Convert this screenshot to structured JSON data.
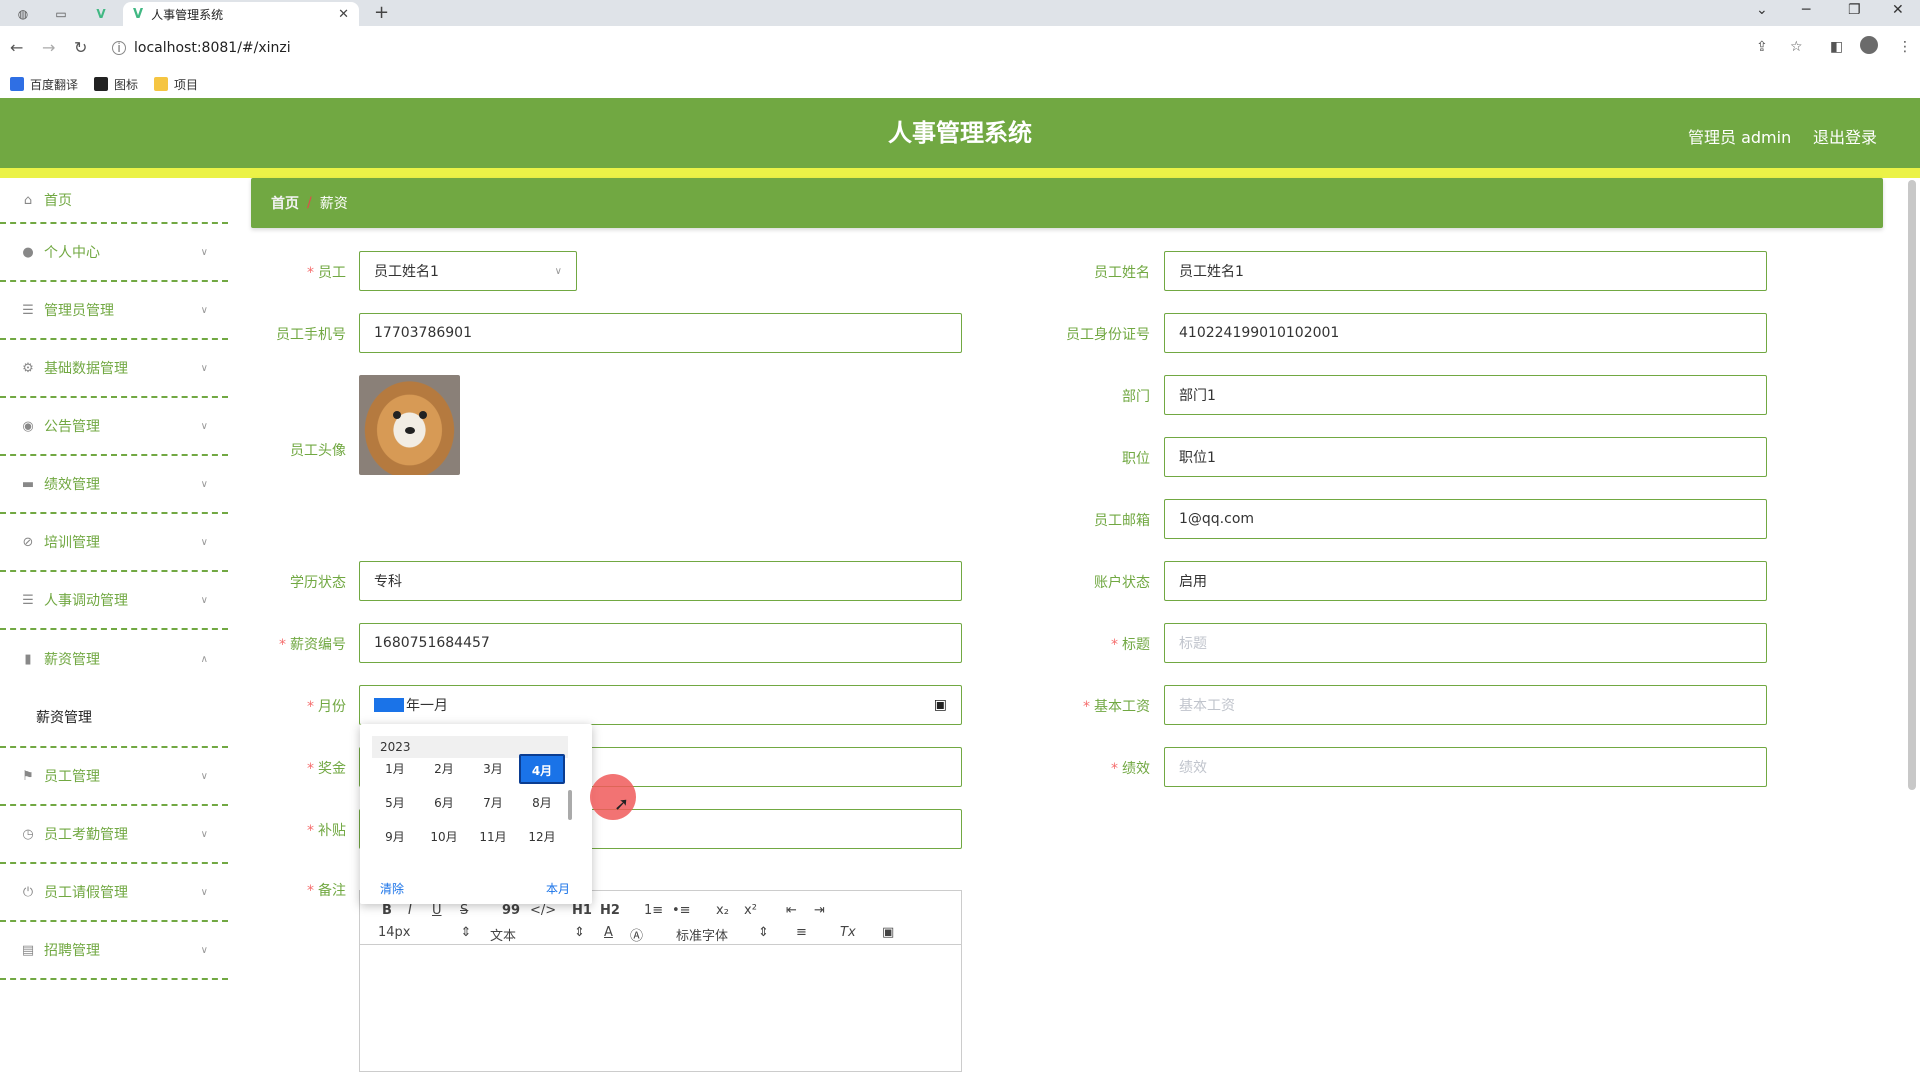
{
  "browser": {
    "tab_title": "人事管理系统",
    "new_tab": "+",
    "url": "localhost:8081/#/xinzi",
    "bookmarks": [
      {
        "label": "百度翻译",
        "color": "#2f6fe4"
      },
      {
        "label": "图标",
        "color": "#222222"
      },
      {
        "label": "项目",
        "color": "#f5c542"
      }
    ]
  },
  "header": {
    "title": "人事管理系统",
    "user": "管理员 admin",
    "logout": "退出登录",
    "bg_color": "#71a842",
    "accent_color": "#ebf247"
  },
  "sidebar": {
    "items": [
      {
        "label": "首页",
        "icon": "home-icon"
      },
      {
        "label": "个人中心",
        "icon": "user-icon"
      },
      {
        "label": "管理员管理",
        "icon": "list-icon"
      },
      {
        "label": "基础数据管理",
        "icon": "settings-icon"
      },
      {
        "label": "公告管理",
        "icon": "pin-icon"
      },
      {
        "label": "绩效管理",
        "icon": "chat-icon"
      },
      {
        "label": "培训管理",
        "icon": "compass-icon"
      },
      {
        "label": "人事调动管理",
        "icon": "list-icon"
      },
      {
        "label": "薪资管理",
        "icon": "bar-chart-icon"
      },
      {
        "label": "员工管理",
        "icon": "flag-icon"
      },
      {
        "label": "员工考勤管理",
        "icon": "clock-icon"
      },
      {
        "label": "员工请假管理",
        "icon": "power-icon"
      },
      {
        "label": "招聘管理",
        "icon": "card-icon"
      }
    ],
    "submenu_label": "薪资管理"
  },
  "breadcrumb": {
    "home": "首页",
    "sep": "/",
    "current": "薪资"
  },
  "form": {
    "employee": {
      "label": "员工",
      "value": "员工姓名1"
    },
    "employee_name": {
      "label": "员工姓名",
      "value": "员工姓名1"
    },
    "phone": {
      "label": "员工手机号",
      "value": "17703786901"
    },
    "id_card": {
      "label": "员工身份证号",
      "value": "410224199010102001"
    },
    "avatar_label": "员工头像",
    "department": {
      "label": "部门",
      "value": "部门1"
    },
    "position": {
      "label": "职位",
      "value": "职位1"
    },
    "email": {
      "label": "员工邮箱",
      "value": "1@qq.com"
    },
    "education": {
      "label": "学历状态",
      "value": "专科"
    },
    "account_status": {
      "label": "账户状态",
      "value": "启用"
    },
    "salary_no": {
      "label": "薪资编号",
      "value": "1680751684457"
    },
    "title": {
      "label": "标题",
      "placeholder": "标题"
    },
    "month": {
      "label": "月份",
      "value": "年一月"
    },
    "base_salary": {
      "label": "基本工资",
      "placeholder": "基本工资"
    },
    "bonus": {
      "label": "奖金"
    },
    "performance": {
      "label": "绩效",
      "placeholder": "绩效"
    },
    "allowance": {
      "label": "补贴"
    },
    "remark": {
      "label": "备注"
    }
  },
  "month_picker": {
    "year": "2023",
    "months": [
      "1月",
      "2月",
      "3月",
      "4月",
      "5月",
      "6月",
      "7月",
      "8月",
      "9月",
      "10月",
      "11月",
      "12月"
    ],
    "selected": "4月",
    "clear": "清除",
    "this_month": "本月"
  },
  "editor": {
    "font_size": "14px",
    "text_type": "文本",
    "font_family": "标准字体",
    "buttons": [
      "B",
      "I",
      "U",
      "S",
      "99",
      "</>",
      "H1",
      "H2",
      "1≡",
      "•≡",
      "x₂",
      "x²",
      "⇤",
      "⇥"
    ]
  }
}
